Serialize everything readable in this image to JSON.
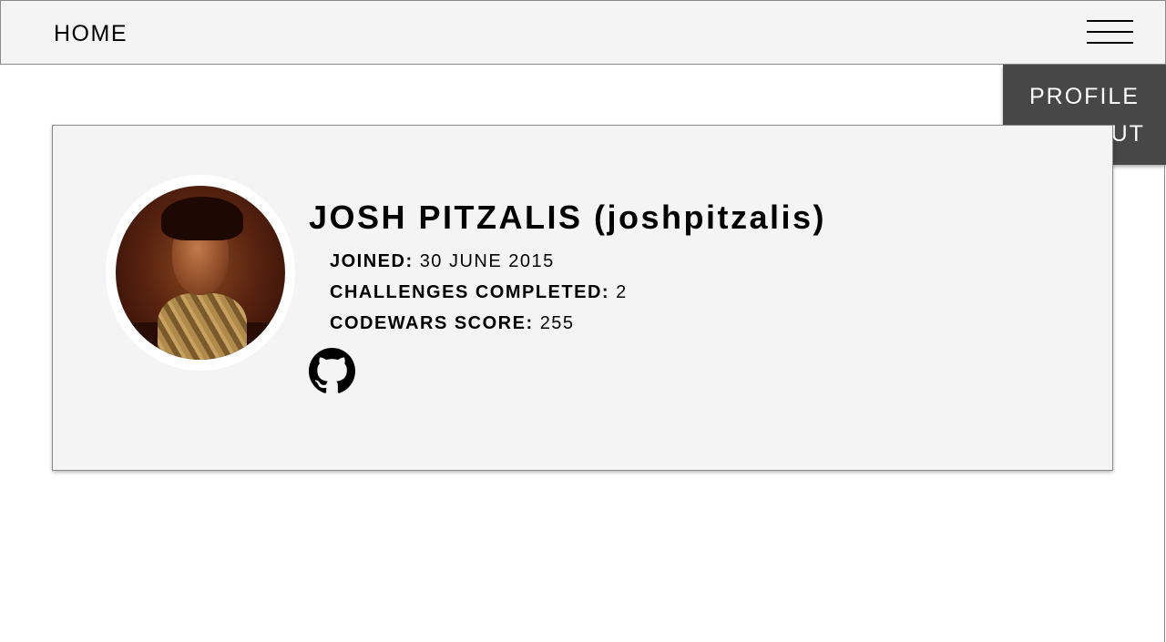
{
  "nav": {
    "home_label": "HOME",
    "menu_icon": "hamburger-menu-icon"
  },
  "dropdown": {
    "items": [
      {
        "label": "PROFILE"
      },
      {
        "label": "SIGN OUT"
      }
    ]
  },
  "profile": {
    "name": "JOSH PITZALIS (joshpitzalis)",
    "joined_label": "JOINED:",
    "joined_value": "30 JUNE 2015",
    "challenges_label": "CHALLENGES COMPLETED:",
    "challenges_value": "2",
    "codewars_label": "CODEWARS SCORE:",
    "codewars_value": "255",
    "github_icon": "github-icon"
  },
  "colors": {
    "bar_bg": "#f4f4f4",
    "dropdown_bg": "#474747",
    "border": "#8a8a8a"
  }
}
